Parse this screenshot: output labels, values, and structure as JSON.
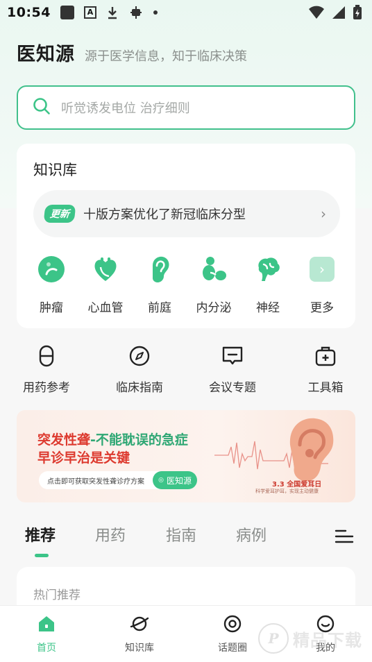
{
  "statusbar": {
    "time": "10:54"
  },
  "header": {
    "brand": "医知源",
    "slogan": "源于医学信息，知于临床决策"
  },
  "search": {
    "placeholder": "听觉诱发电位 治疗细则"
  },
  "knowledge": {
    "title": "知识库",
    "update_badge": "更新",
    "update_text": "十版方案优化了新冠临床分型",
    "categories": [
      {
        "label": "肿瘤",
        "icon": "tumor-icon"
      },
      {
        "label": "心血管",
        "icon": "heart-icon"
      },
      {
        "label": "前庭",
        "icon": "ear-icon"
      },
      {
        "label": "内分泌",
        "icon": "endocrine-icon"
      },
      {
        "label": "神经",
        "icon": "brain-icon"
      },
      {
        "label": "更多",
        "icon": "chevron-right-icon"
      }
    ]
  },
  "tools": [
    {
      "label": "用药参考",
      "icon": "capsule-icon"
    },
    {
      "label": "临床指南",
      "icon": "compass-icon"
    },
    {
      "label": "会议专题",
      "icon": "chat-icon"
    },
    {
      "label": "工具箱",
      "icon": "toolbox-icon"
    }
  ],
  "banner": {
    "headline_part1": "突发性聋",
    "headline_part2": "-不能耽误的急症",
    "line2": "早诊早治是关键",
    "pill_text": "点击即可获取突发性聋诊疗方案",
    "logo_text": "医知源",
    "date_text": "3.3 全国爱耳日",
    "sub_text": "科学爱耳护耳，实现主动健康"
  },
  "tabs": [
    {
      "label": "推荐",
      "active": true
    },
    {
      "label": "用药",
      "active": false
    },
    {
      "label": "指南",
      "active": false
    },
    {
      "label": "病例",
      "active": false
    }
  ],
  "feed": {
    "section_title": "热门推荐"
  },
  "bottom_nav": [
    {
      "label": "首页",
      "icon": "home-icon",
      "active": true
    },
    {
      "label": "知识库",
      "icon": "planet-icon",
      "active": false
    },
    {
      "label": "话题圈",
      "icon": "target-icon",
      "active": false
    },
    {
      "label": "我的",
      "icon": "smile-icon",
      "active": false
    }
  ],
  "watermark": {
    "text": "精品下载"
  },
  "colors": {
    "accent": "#3cc488",
    "banner_red": "#dd3a2f"
  }
}
